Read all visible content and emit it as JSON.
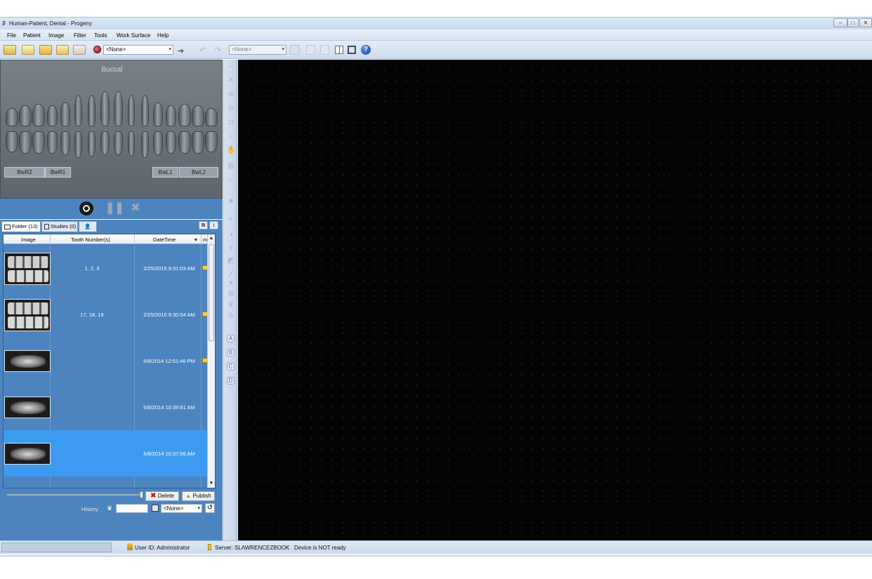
{
  "window": {
    "title": "Human-Patient, Dental - Progeny",
    "controls": [
      "minimize-icon",
      "maximize-icon",
      "close-icon"
    ]
  },
  "menubar": {
    "items": [
      "File",
      "Patient",
      "Image",
      "Filter",
      "Tools",
      "Work Surface",
      "Help"
    ]
  },
  "toolbar": {
    "procedure_select": "<None>",
    "secondary_select": "<None>",
    "icons": [
      "open-patient-icon",
      "patient-card-icon",
      "folder-icon",
      "edit-patient-icon",
      "patient-info-icon",
      "record-icon",
      "acquire-arrow-icon",
      "undo-icon",
      "redo-icon",
      "export-icon",
      "copy-icon",
      "paste-icon",
      "layout-grid-icon",
      "fullscreen-icon",
      "help-icon"
    ]
  },
  "tooth_chart": {
    "view_label": "Buccal",
    "bitewing_buttons": [
      "BwR2",
      "BwR1",
      "BwL1",
      "BwL2"
    ]
  },
  "acquisition": {
    "icons": [
      "radiation-icon",
      "pause-icon",
      "cancel-icon"
    ]
  },
  "tabs": {
    "folder": "Folder (13)",
    "studies": "Studies (0)",
    "tab3_icon": "person-icon"
  },
  "image_list": {
    "columns": [
      "Image",
      "Tooth Number(s)",
      "DateTime",
      "m"
    ],
    "rows": [
      {
        "teeth": "1, 2, 3",
        "datetime": "2/25/2015 9:31:03 AM",
        "flag": true,
        "type": "bitewing"
      },
      {
        "teeth": "17, 18, 19",
        "datetime": "2/25/2015 9:30:54 AM",
        "flag": true,
        "type": "bitewing"
      },
      {
        "teeth": "",
        "datetime": "5/8/2014 12:51:46 PM",
        "flag": true,
        "type": "panoramic"
      },
      {
        "teeth": "",
        "datetime": "5/8/2014 10:39:51 AM",
        "flag": false,
        "type": "panoramic"
      },
      {
        "teeth": "",
        "datetime": "5/8/2014 10:37:06 AM",
        "flag": false,
        "type": "panoramic",
        "selected": true
      }
    ]
  },
  "actions": {
    "delete": "Delete",
    "publish": "Publish",
    "history_label": "History:",
    "history_select": "<None>"
  },
  "toolstrip": {
    "letters": [
      "A",
      "B",
      "C",
      "D"
    ]
  },
  "statusbar": {
    "user": "User ID:  Administrator",
    "server": "Server:  SLAWRENCEZBOOK",
    "device": "Device is NOT ready"
  },
  "colors": {
    "panel_blue": "#4d84c0",
    "selected_row": "#3c9bf0",
    "workspace": "#040505"
  }
}
